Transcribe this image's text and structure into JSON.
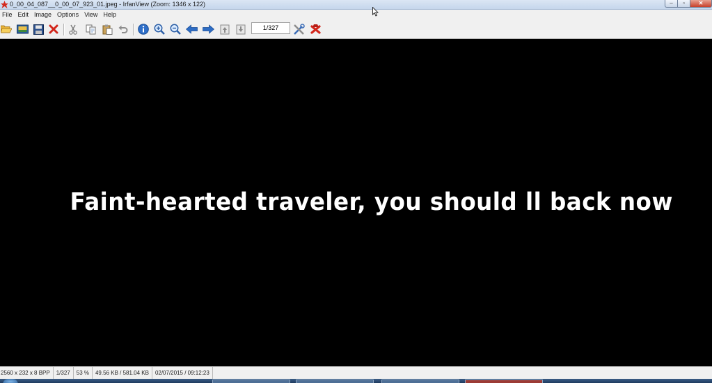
{
  "window": {
    "title": "0_00_04_087__0_00_07_923_01.jpeg - IrfanView (Zoom: 1346 x 122)",
    "minimize_label": "–",
    "maximize_label": "▫",
    "close_label": "✕"
  },
  "menu": {
    "items": [
      "File",
      "Edit",
      "Image",
      "Options",
      "View",
      "Help"
    ]
  },
  "toolbar": {
    "page_indicator": "1/327",
    "buttons": [
      {
        "name": "open-icon"
      },
      {
        "name": "slideshow-icon"
      },
      {
        "name": "save-icon"
      },
      {
        "name": "delete-icon"
      },
      {
        "name": "cut-icon"
      },
      {
        "name": "copy-icon"
      },
      {
        "name": "paste-icon"
      },
      {
        "name": "undo-icon"
      },
      {
        "name": "info-icon"
      },
      {
        "name": "zoom-in-icon"
      },
      {
        "name": "zoom-out-icon"
      },
      {
        "name": "previous-icon"
      },
      {
        "name": "next-icon"
      },
      {
        "name": "first-page-icon"
      },
      {
        "name": "last-page-icon"
      },
      {
        "name": "settings-icon"
      },
      {
        "name": "exit-icon"
      }
    ]
  },
  "image": {
    "subtitle_text": "Faint-hearted traveler, you should    ll back now"
  },
  "statusbar": {
    "dimensions": "2560 x 232 x 8 BPP",
    "page": "1/327",
    "zoom": "53 %",
    "filesize": "49.56 KB / 581.04 KB",
    "datetime": "02/07/2015 / 09:12:23"
  },
  "colors": {
    "canvas_bg": "#000000",
    "subtitle_color": "#ffffff",
    "chrome_bg": "#f0f0f0",
    "close_red": "#c7402a"
  }
}
